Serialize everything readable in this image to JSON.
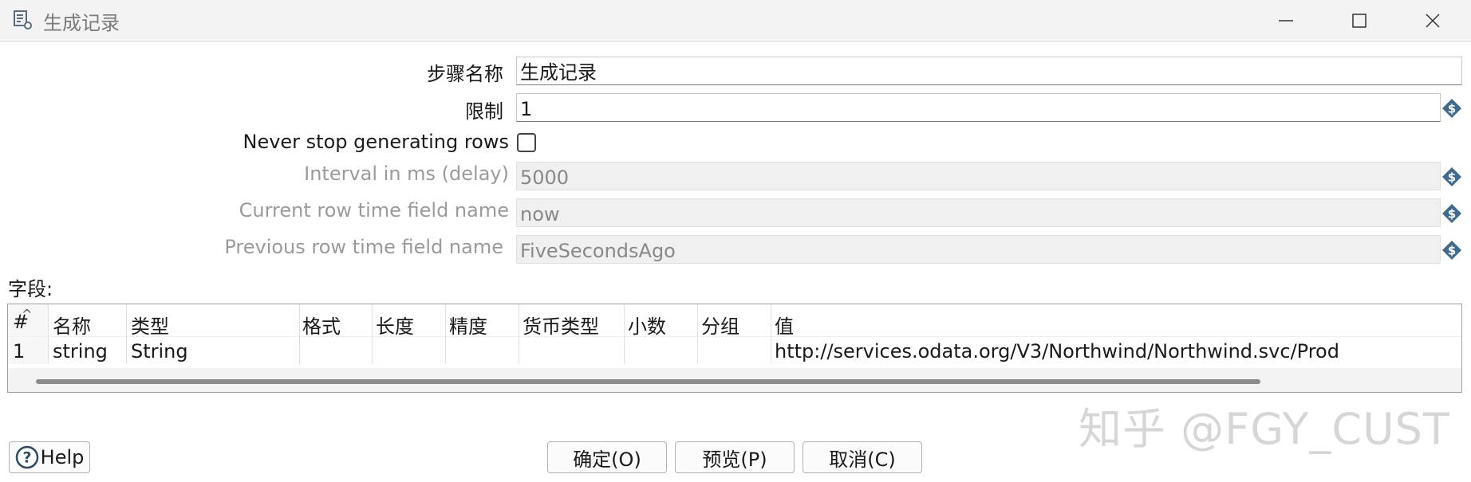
{
  "window": {
    "title": "生成记录",
    "icon": "step-icon",
    "controls": [
      "minimize-icon",
      "maximize-icon",
      "close-icon"
    ]
  },
  "form": {
    "step_name": {
      "label": "步骤名称",
      "value": "生成记录"
    },
    "limit": {
      "label": "限制",
      "value": "1"
    },
    "never_stop": {
      "label": "Never stop generating rows",
      "checked": false
    },
    "interval": {
      "label": "Interval in ms (delay)",
      "value": "5000",
      "disabled": true
    },
    "current_row_time": {
      "label": "Current row time field name",
      "value": "now",
      "disabled": true
    },
    "previous_row_time": {
      "label": "Previous row time field name",
      "value": "FiveSecondsAgo",
      "disabled": true
    },
    "variable_icon": "dollar-variable-icon"
  },
  "fields": {
    "section_label": "字段:",
    "columns": [
      "#",
      "名称",
      "类型",
      "格式",
      "长度",
      "精度",
      "货币类型",
      "小数",
      "分组",
      "值"
    ],
    "rows": [
      {
        "num": "1",
        "name": "string",
        "type": "String",
        "format": "",
        "length": "",
        "precision": "",
        "currency": "",
        "decimal": "",
        "group": "",
        "value": "http://services.odata.org/V3/Northwind/Northwind.svc/Prod"
      }
    ]
  },
  "watermark": "知乎 @FGY_CUST",
  "buttons": {
    "help": "Help",
    "ok": "确定(O)",
    "preview": "预览(P)",
    "cancel": "取消(C)"
  }
}
